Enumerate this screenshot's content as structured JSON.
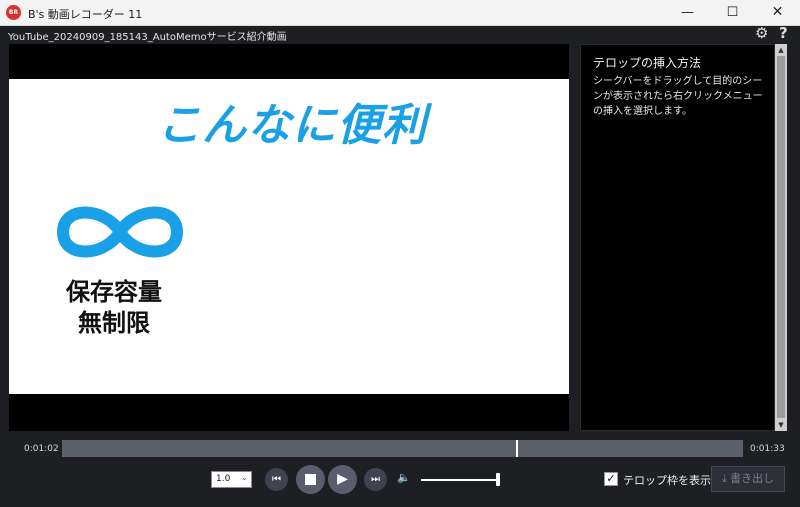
{
  "window": {
    "title": "B's 動画レコーダー 11",
    "app_icon_text": "BR",
    "minimize_glyph": "—",
    "maximize_glyph": "☐",
    "close_glyph": "✕"
  },
  "file": {
    "name": "YouTube_20240909_185143_AutoMemoサービス紹介動画",
    "settings_glyph": "⚙",
    "help_glyph": "?"
  },
  "video": {
    "headline": "こんなに便利",
    "storage_line1": "保存容量",
    "storage_line2": "無制限",
    "accent_color": "#1aa0e6"
  },
  "panel": {
    "title": "テロップの挿入方法",
    "body": "シークバーをドラッグして目的のシーンが表示されたら右クリックメニューの挿入を選択します。"
  },
  "scrollbar": {
    "up_glyph": "▲",
    "down_glyph": "▼"
  },
  "timeline": {
    "current_time": "0:01:02",
    "total_time": "0:01:33",
    "position_fraction": 0.667
  },
  "controls": {
    "speed_value": "1.0",
    "speed_arrow": "⌄",
    "prev_glyph": "⏮",
    "play_glyph": "▶",
    "next_glyph": "⏭",
    "volume_glyph": "🔈",
    "volume_level": 1.0,
    "show_telop_checked": true,
    "check_glyph": "✓",
    "show_telop_label": "テロップ枠を表示",
    "export_label": "⤓ 書き出し"
  }
}
